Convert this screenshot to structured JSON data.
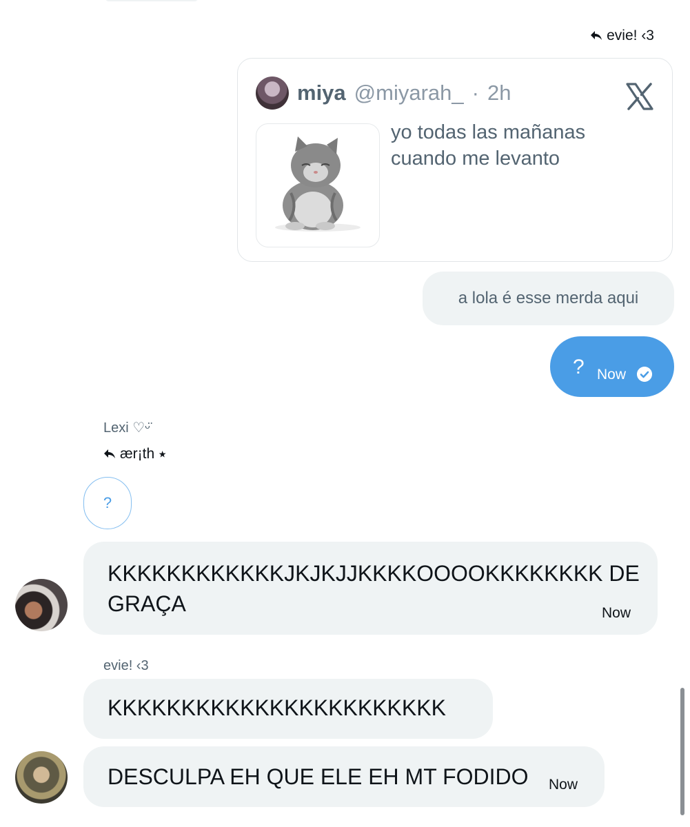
{
  "previous_message": {},
  "reply_to_evie": {
    "label": "evie! ‹3"
  },
  "tweet_card": {
    "name": "miya",
    "handle": "@miyarah_",
    "separator": "·",
    "time": "2h",
    "text": "yo todas las mañanas cuando me levanto",
    "logo_icon": "x-logo-icon",
    "image_icon": "kitten-photo"
  },
  "messages": {
    "lola": {
      "text": "a lola é esse merda aqui"
    },
    "question_sent": {
      "text": "?",
      "time": "Now",
      "status_icon": "check-circle-icon",
      "color": "#4a9de6"
    },
    "lexi_sender": {
      "name": "Lexi ♡ᵕ̈"
    },
    "reply_to_aerith": {
      "label": "ær¡th ⭑"
    },
    "question_quoted": {
      "text": "?"
    },
    "kk_long": {
      "text": "KKKKKKKKKKKKJKJKJJKKKKOOOOKKKKKKKK DE GRAÇA",
      "time": "Now"
    },
    "evie_sender": {
      "name": "evie! ‹3"
    },
    "kk_short": {
      "text": "KKKKKKKKKKKKKKKKKKKKKKK"
    },
    "desculpa": {
      "text": "DESCULPA EH QUE ELE EH MT FODIDO",
      "time": "Now"
    }
  },
  "colors": {
    "accent": "#4a9de6",
    "bubble_grey": "#eff3f4",
    "muted": "#536471"
  }
}
